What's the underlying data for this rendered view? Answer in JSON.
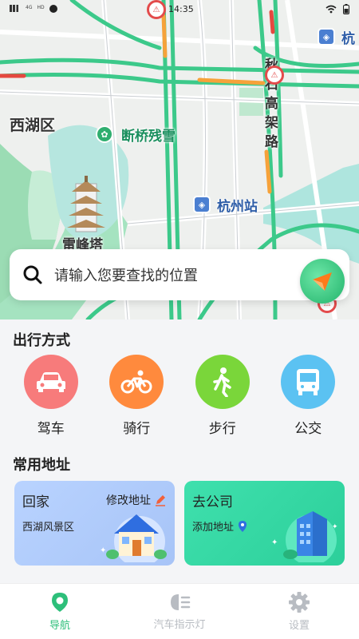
{
  "status_bar": {
    "time": "14:35",
    "left_text": [
      "4G",
      "HD"
    ],
    "icons": [
      "signal-icon",
      "notification-icon",
      "wifi-icon",
      "battery-icon"
    ]
  },
  "map": {
    "district": "西湖区",
    "poi": "断桥残雪",
    "pagoda": "雷峰塔",
    "station": "杭州站",
    "road": "秋石高架路",
    "edge_label": "杭"
  },
  "search": {
    "placeholder": "请输入您要查找的位置"
  },
  "travel": {
    "title": "出行方式",
    "modes": [
      {
        "label": "驾车",
        "icon": "car-icon",
        "color": "#f77b7b"
      },
      {
        "label": "骑行",
        "icon": "bicycle-icon",
        "color": "#ff8a3d"
      },
      {
        "label": "步行",
        "icon": "walk-icon",
        "color": "#7ad63a"
      },
      {
        "label": "公交",
        "icon": "bus-icon",
        "color": "#5bc2f2"
      }
    ]
  },
  "addresses": {
    "title": "常用地址",
    "home": {
      "title": "回家",
      "subtitle": "西湖风景区",
      "action": "修改地址"
    },
    "work": {
      "title": "去公司",
      "action": "添加地址"
    }
  },
  "tabs": [
    {
      "label": "导航",
      "icon": "navigation-icon",
      "active": true
    },
    {
      "label": "汽车指示灯",
      "icon": "car-light-icon",
      "active": false
    },
    {
      "label": "设置",
      "icon": "gear-icon",
      "active": false
    }
  ],
  "colors": {
    "accent": "#2dbf7a",
    "inactive_tab": "#b8bcc2"
  }
}
